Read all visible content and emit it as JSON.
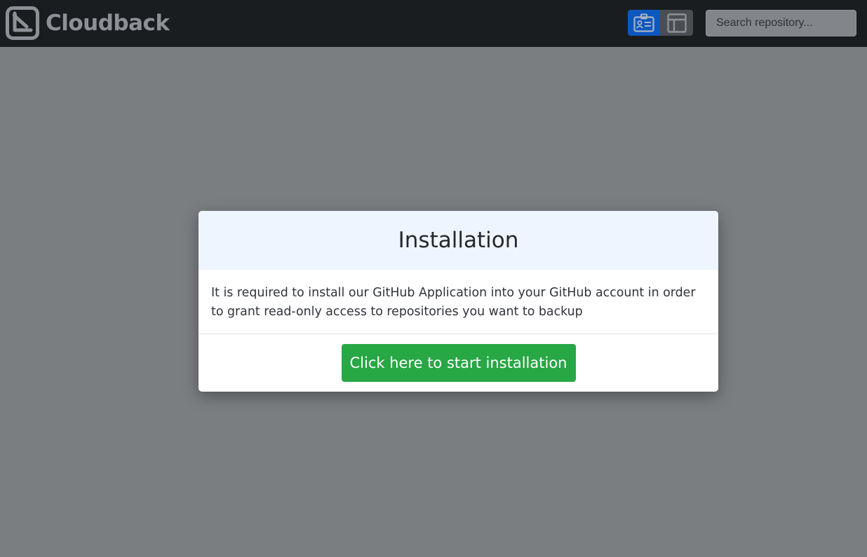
{
  "navbar": {
    "brand_name": "Cloudback",
    "logo_icon": "cloudback-logo-icon",
    "view_toggle": {
      "card_view_icon": "id-card-icon",
      "table_view_icon": "table-layout-icon",
      "active": "card"
    },
    "search": {
      "placeholder": "Search repository...",
      "value": ""
    }
  },
  "modal": {
    "title": "Installation",
    "body_text": "It is required to install our GitHub Application into your GitHub account in order to grant read-only access to repositories you want to backup",
    "button_label": "Click here to start installation"
  },
  "colors": {
    "navbar_bg": "#1a1d20",
    "backdrop": "#7b7e81",
    "active_toggle": "#0d57c0",
    "modal_header_bg": "#eef5fe",
    "primary_button": "#28a745"
  }
}
